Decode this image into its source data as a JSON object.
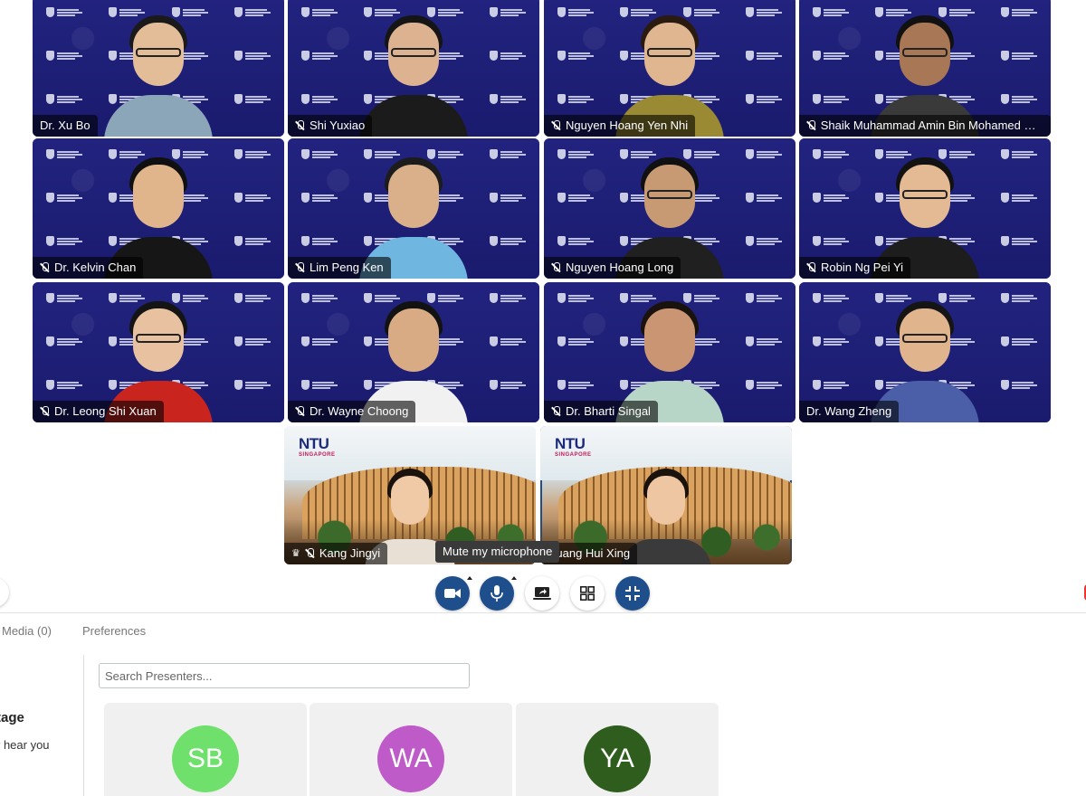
{
  "participants": [
    {
      "name": "Dr. Xu Bo",
      "muted": false
    },
    {
      "name": "Shi Yuxiao",
      "muted": true
    },
    {
      "name": "Nguyen Hoang Yen Nhi",
      "muted": true
    },
    {
      "name": "Shaik Muhammad Amin Bin Mohamed Ba...",
      "muted": true
    },
    {
      "name": "Dr. Kelvin Chan",
      "muted": true
    },
    {
      "name": "Lim Peng Ken",
      "muted": true
    },
    {
      "name": "Nguyen Hoang Long",
      "muted": true
    },
    {
      "name": "Robin Ng Pei Yi",
      "muted": true
    },
    {
      "name": "Dr. Leong Shi Xuan",
      "muted": true
    },
    {
      "name": "Dr. Wayne Choong",
      "muted": true
    },
    {
      "name": "Dr. Bharti Singal",
      "muted": true
    },
    {
      "name": "Dr. Wang Zheng",
      "muted": false
    },
    {
      "name": "Kang Jingyi",
      "muted": true,
      "host": true
    },
    {
      "name": "Huang Hui Xing",
      "muted": false
    }
  ],
  "background_logo": {
    "text": "NTU",
    "subtext": "SINGAPORE"
  },
  "tooltip": "Mute my microphone",
  "controls": {
    "camera": "camera-icon",
    "microphone": "microphone-icon",
    "share_screen": "share-screen-icon",
    "grid_view": "grid-icon",
    "exit_fullscreen": "minimize-icon"
  },
  "panel": {
    "tabs": [
      "Media (0)",
      "Preferences"
    ],
    "left_title": "tage",
    "left_subtitle": "r hear you",
    "search_placeholder": "Search Presenters...",
    "presenters": [
      {
        "initials": "SB",
        "color": "#6ee06b"
      },
      {
        "initials": "WA",
        "color": "#bf5ac9"
      },
      {
        "initials": "YA",
        "color": "#2f5d1e"
      }
    ]
  },
  "colors": {
    "accent": "#1e4f8c",
    "tile_bg": "#1d1e78"
  }
}
